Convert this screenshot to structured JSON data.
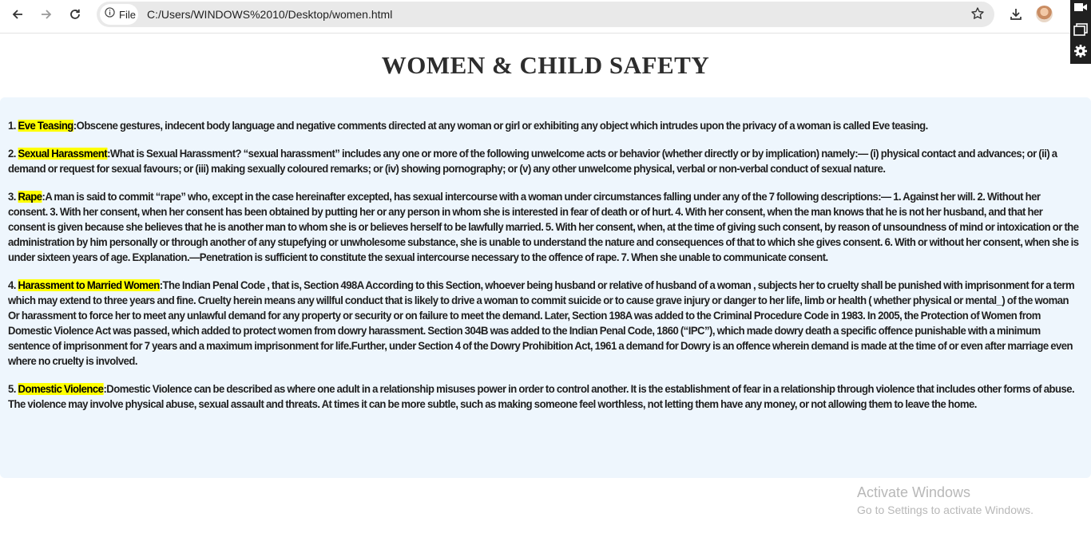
{
  "browser": {
    "chip_label": "File",
    "url": "C:/Users/WINDOWS%2010/Desktop/women.html",
    "icons": [
      "back-icon",
      "forward-icon",
      "reload-icon",
      "info-icon",
      "star-icon",
      "download-icon",
      "avatar",
      "camera-icon",
      "window-icon",
      "gear-icon"
    ]
  },
  "page": {
    "title": "WOMEN & CHILD SAFETY",
    "highlight_color": "#ffff00",
    "panel_color": "#eef6fd",
    "items": [
      {
        "num": "1.",
        "term": "Eve Teasing",
        "sep": ":",
        "text": "Obscene gestures, indecent body language and negative comments directed at any woman or girl or exhibiting any object which intrudes upon the privacy of a woman is called Eve teasing."
      },
      {
        "num": "2.",
        "term": "Sexual Harassment",
        "sep": ":",
        "text": "What is Sexual Harassment? “sexual harassment” includes any one or more of the following unwelcome acts or behavior (whether directly or by implication) namely:— (i) physical contact and advances; or (ii) a demand or request for sexual favours; or (iii) making sexually coloured remarks; or (iv) showing pornography; or (v) any other unwelcome physical, verbal or non-verbal conduct of sexual nature."
      },
      {
        "num": "3.",
        "term": "Rape",
        "sep": ":",
        "text": "A man is said to commit “rape” who, except in the case hereinafter excepted, has sexual intercourse with a woman under circumstances falling under any of the 7 following descriptions:— 1. Against her will. 2. Without her consent. 3. With her consent, when her consent has been obtained by putting her or any person in whom she is interested in fear of death or of hurt. 4. With her consent, when the man knows that he is not her husband, and that her consent is given because she believes that he is another man to whom she is or believes herself to be lawfully married. 5. With her consent, when, at the time of giving such consent, by reason of unsoundness of mind or intoxication or the administration by him personally or through another of any stupefying or unwholesome substance, she is unable to understand the nature and consequences of that to which she gives consent. 6. With or without her consent, when she is under sixteen years of age. Explanation.—Penetration is sufficient to constitute the sexual intercourse necessary to the offence of rape. 7. When she unable to communicate consent."
      },
      {
        "num": "4.",
        "term": "Harassment to Married Women",
        "sep": ":",
        "text": "The Indian Penal Code , that is, Section 498A According to this Section, whoever being husband or relative of husband of a woman , subjects her to cruelty shall be punished with imprisonment for a term which may extend to three years and fine. Cruelty herein means any willful conduct that is likely to drive a woman to commit suicide or to cause grave injury or danger to her life, limb or health ( whether physical or mental_) of the woman Or harassment to force her to meet any unlawful demand for any property or security or on failure to meet the demand. Later, Section 198A was added to the Criminal Procedure Code in 1983. In 2005, the Protection of Women from Domestic Violence Act was passed, which added to protect women from dowry harassment. Section 304B was added to the Indian Penal Code, 1860 (“IPC”), which made dowry death a specific offence punishable with a minimum sentence of imprisonment for 7 years and a maximum imprisonment for life.Further, under Section 4 of the Dowry Prohibition Act, 1961 a demand for Dowry is an offence wherein demand is made at the time of or even after marriage even where no cruelty is involved."
      },
      {
        "num": "5.",
        "term": "Domestic Violence",
        "sep": ":",
        "text": "Domestic Violence can be described as where one adult in a relationship misuses power in order to control another. It is the establishment of fear in a relationship through violence that includes other forms of abuse. The violence may involve physical abuse, sexual assault and threats. At times it can be more subtle, such as making someone feel worthless, not letting them have any money, or not allowing them to leave the home."
      }
    ]
  },
  "watermark": {
    "line1": "Activate Windows",
    "line2": "Go to Settings to activate Windows."
  }
}
